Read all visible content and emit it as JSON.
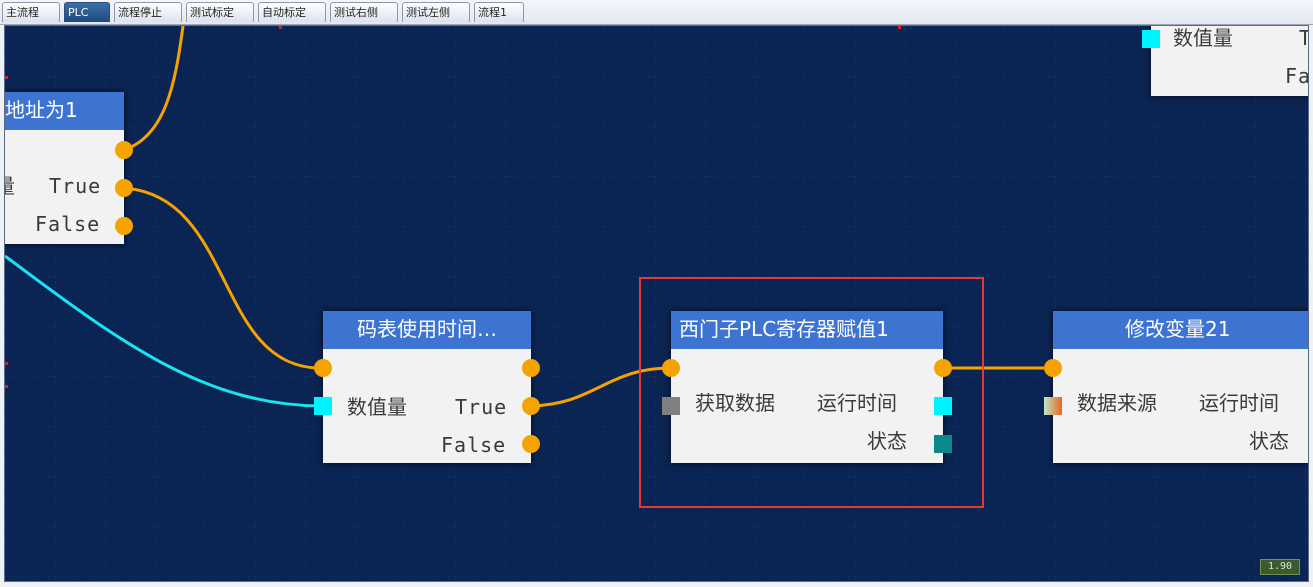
{
  "tabs": [
    {
      "label": "主流程",
      "active": false
    },
    {
      "label": "PLC",
      "active": true
    },
    {
      "label": "流程停止",
      "active": false
    },
    {
      "label": "测试标定",
      "active": false
    },
    {
      "label": "自动标定",
      "active": false
    },
    {
      "label": "测试右侧",
      "active": false
    },
    {
      "label": "测试左侧",
      "active": false
    },
    {
      "label": "流程1",
      "active": false
    }
  ],
  "nodes": {
    "address_node": {
      "title": "地址为1",
      "input_label": "量",
      "true_label": "True",
      "false_label": "False"
    },
    "meter_time_node": {
      "title": "码表使用时间…",
      "input_label": "数值量",
      "true_label": "True",
      "false_label": "False"
    },
    "siemens_node": {
      "title": "西门子PLC寄存器赋值1",
      "input_label": "获取数据",
      "output_label": "运行时间",
      "status_label": "状态"
    },
    "modify_var_node": {
      "title": "修改变量21",
      "input_label": "数据来源",
      "output_label": "运行时间",
      "status_label": "状态"
    },
    "topright_node": {
      "input_label": "数值量",
      "true_label": "Tr",
      "false_label": "Fal"
    }
  },
  "colors": {
    "canvas_bg": "#0a2453",
    "node_header": "#3d74d1",
    "node_body": "#f2f2f2",
    "flow_wire": "#f5a300",
    "data_wire": "#19e3f0",
    "selection": "#e53935",
    "port_cyan": "#00f2ff",
    "port_teal": "#0a8a8a",
    "port_gray": "#808080"
  },
  "zoom": "1.90"
}
